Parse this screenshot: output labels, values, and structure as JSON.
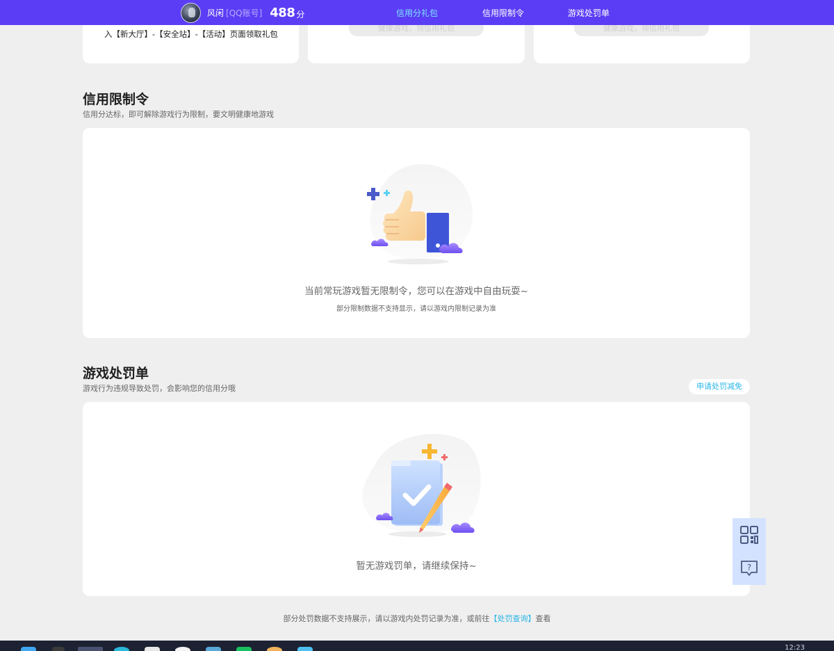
{
  "user": {
    "name": "风闲",
    "account_type": "[QQ账号]",
    "score": "488",
    "score_unit": "分"
  },
  "nav": {
    "items": [
      {
        "label": "信用分礼包",
        "active": true
      },
      {
        "label": "信用限制令",
        "active": false
      },
      {
        "label": "游戏处罚单",
        "active": false
      }
    ]
  },
  "gift_cards": {
    "card1_text": "入【新大厅】-【安全站】-【活动】页面领取礼包",
    "card2_button": "健康游戏，领信用礼包",
    "card3_button": "健康游戏，领信用礼包"
  },
  "restriction": {
    "title": "信用限制令",
    "subtitle": "信用分达标，即可解除游戏行为限制，要文明健康地游戏",
    "empty_text": "当前常玩游戏暂无限制令，您可以在游戏中自由玩耍~",
    "empty_note": "部分限制数据不支持显示，请以游戏内限制记录为准",
    "illustration_icon": "thumbs-up-icon"
  },
  "penalty": {
    "title": "游戏处罚单",
    "subtitle": "游戏行为违规导致处罚，会影响您的信用分哦",
    "appeal_button": "申请处罚减免",
    "empty_text": "暂无游戏罚单，请继续保持~",
    "illustration_icon": "checklist-pencil-icon"
  },
  "footer": {
    "note_prefix": "部分处罚数据不支持展示，请以游戏内处罚记录为准，或前往",
    "link_text": "【处罚查询】",
    "note_suffix": "查看"
  },
  "float_buttons": {
    "qr_icon": "qr-code-icon",
    "help_icon": "help-chat-icon"
  },
  "taskbar": {
    "clock": "12:23"
  },
  "colors": {
    "brand": "#5b3df5",
    "link": "#29b6e6",
    "active_nav": "#7ee6ff",
    "page_bg": "#efefef"
  }
}
